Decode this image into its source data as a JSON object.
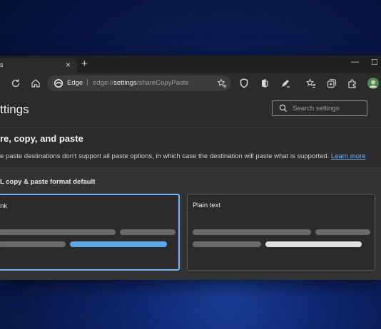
{
  "browser": {
    "tab_title": "s",
    "tab_close": "×",
    "new_tab": "+",
    "min_btn": "—",
    "max_btn": "☐",
    "address": {
      "edge_label": "Edge",
      "separator": "|",
      "url_prefix": "edge://",
      "url_bold": "settings",
      "url_suffix": "/shareCopyPaste"
    }
  },
  "settings": {
    "page_title": "ttings",
    "search_placeholder": "Search settings",
    "section_title": "re, copy, and paste",
    "description": "e paste destinations don't support all paste options, in which case the destination will paste what is supported.",
    "learn_more": "Learn more",
    "panel_label": "L copy & paste format default",
    "options": [
      {
        "label": "ink",
        "selected": true
      },
      {
        "label": "Plain text",
        "selected": false
      }
    ]
  },
  "colors": {
    "accent": "#6cb6ff",
    "selected_bar": "#5fa8e8",
    "plain_bar": "#e0e0e0"
  }
}
